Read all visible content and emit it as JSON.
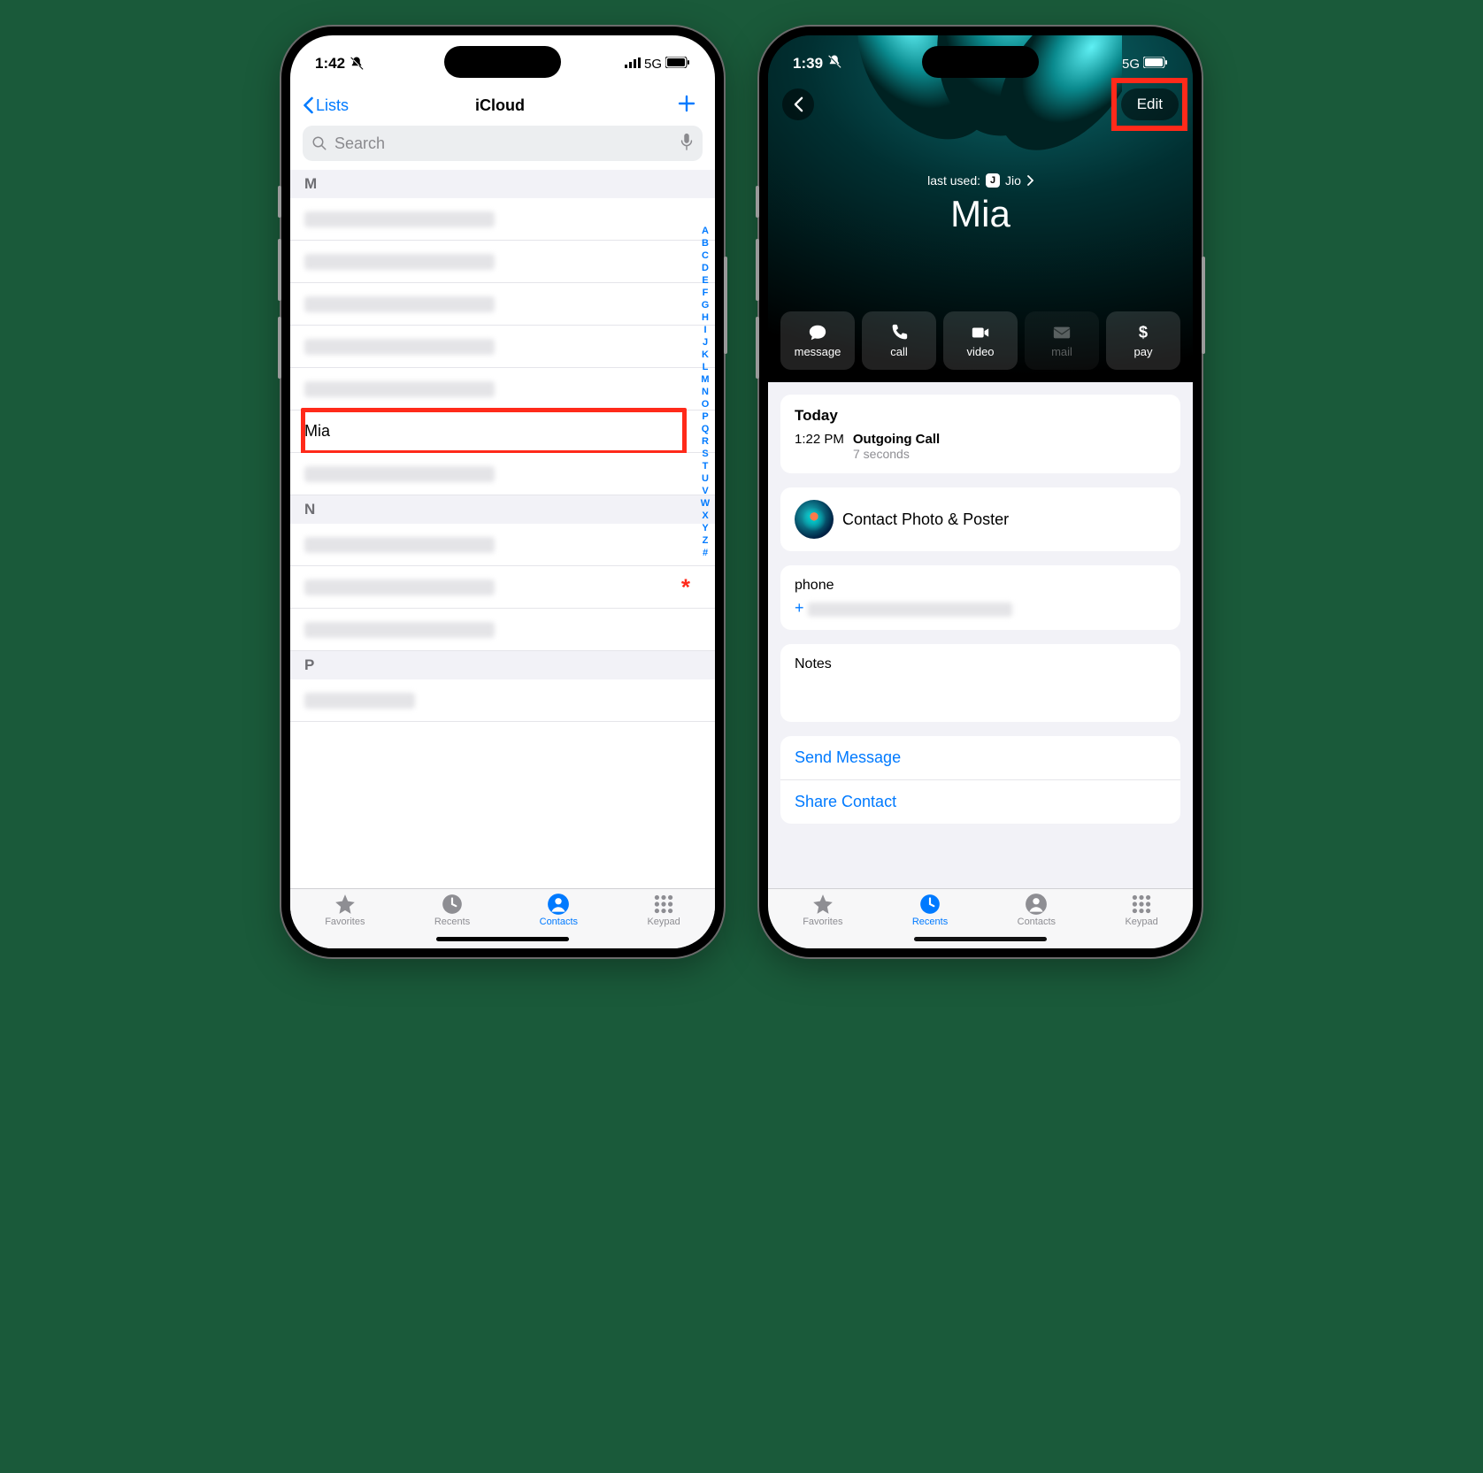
{
  "phone1": {
    "status": {
      "time": "1:42",
      "network": "5G"
    },
    "nav": {
      "back_label": "Lists",
      "title": "iCloud"
    },
    "search": {
      "placeholder": "Search"
    },
    "index_letters": [
      "A",
      "B",
      "C",
      "D",
      "E",
      "F",
      "G",
      "H",
      "I",
      "J",
      "K",
      "L",
      "M",
      "N",
      "O",
      "P",
      "Q",
      "R",
      "S",
      "T",
      "U",
      "V",
      "W",
      "X",
      "Y",
      "Z",
      "#"
    ],
    "sections": [
      {
        "letter": "M",
        "rows": [
          {
            "blurred": true
          },
          {
            "blurred": true
          },
          {
            "blurred": true
          },
          {
            "blurred": true
          },
          {
            "blurred": true
          },
          {
            "blurred": false,
            "name": "Mia",
            "highlight": true
          },
          {
            "blurred": true
          }
        ]
      },
      {
        "letter": "N",
        "rows": [
          {
            "blurred": true
          },
          {
            "blurred": true,
            "asterisk": true
          },
          {
            "blurred": true
          }
        ]
      },
      {
        "letter": "P",
        "rows": [
          {
            "blurred": true,
            "short": true
          }
        ]
      }
    ],
    "tabs": [
      {
        "icon": "star",
        "label": "Favorites",
        "active": false
      },
      {
        "icon": "clock",
        "label": "Recents",
        "active": false
      },
      {
        "icon": "person",
        "label": "Contacts",
        "active": true
      },
      {
        "icon": "grid",
        "label": "Keypad",
        "active": false
      }
    ]
  },
  "phone2": {
    "status": {
      "time": "1:39",
      "network": "5G"
    },
    "edit_label": "Edit",
    "last_used_prefix": "last used:",
    "carrier": "Jio",
    "name": "Mia",
    "actions": [
      {
        "icon": "message",
        "label": "message",
        "enabled": true
      },
      {
        "icon": "call",
        "label": "call",
        "enabled": true
      },
      {
        "icon": "video",
        "label": "video",
        "enabled": true
      },
      {
        "icon": "mail",
        "label": "mail",
        "enabled": false
      },
      {
        "icon": "pay",
        "label": "pay",
        "enabled": true
      }
    ],
    "calls": {
      "heading": "Today",
      "time": "1:22 PM",
      "title": "Outgoing Call",
      "duration": "7 seconds"
    },
    "photo_poster_label": "Contact Photo & Poster",
    "phone_label": "phone",
    "notes_label": "Notes",
    "links": [
      {
        "label": "Send Message"
      },
      {
        "label": "Share Contact"
      }
    ],
    "tabs": [
      {
        "icon": "star",
        "label": "Favorites",
        "active": false
      },
      {
        "icon": "clock",
        "label": "Recents",
        "active": true
      },
      {
        "icon": "person",
        "label": "Contacts",
        "active": false
      },
      {
        "icon": "grid",
        "label": "Keypad",
        "active": false
      }
    ]
  }
}
